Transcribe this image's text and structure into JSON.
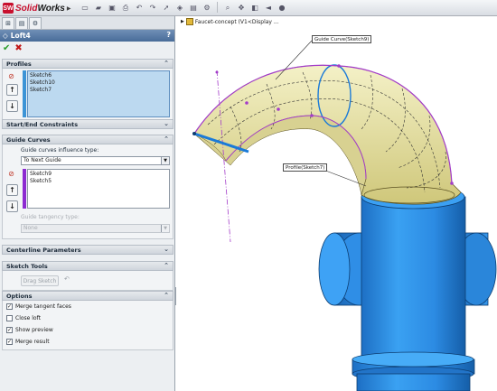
{
  "app": {
    "logo_mark": "SW",
    "brand_prefix": "Solid",
    "brand_suffix": "Works"
  },
  "toolbar": {
    "icons": [
      "new-icon",
      "open-icon",
      "save-icon",
      "print-icon",
      "undo-icon",
      "redo-icon",
      "select-icon",
      "rebuild-icon",
      "file-properties-icon",
      "options-icon",
      "zoom-icon",
      "view-orientation-icon",
      "display-style-icon",
      "section-view-icon",
      "appearance-icon"
    ]
  },
  "property_manager": {
    "title": "Loft4",
    "help": "?",
    "ok": "✔",
    "cancel": "✖",
    "profiles": {
      "header": "Profiles",
      "items": [
        "Sketch6",
        "Sketch10",
        "Sketch7"
      ]
    },
    "start_end": {
      "header": "Start/End Constraints"
    },
    "guide_curves": {
      "header": "Guide Curves",
      "influence_label": "Guide curves influence type:",
      "influence_value": "To Next Guide",
      "items": [
        "Sketch9",
        "Sketch5"
      ],
      "tangency_label": "Guide tangency type:",
      "tangency_value": "None"
    },
    "centerline": {
      "header": "Centerline Parameters"
    },
    "sketch_tools": {
      "header": "Sketch Tools",
      "drag_sketch": "Drag Sketch"
    },
    "options": {
      "header": "Options",
      "checkboxes": [
        {
          "label": "Merge tangent faces",
          "checked": true
        },
        {
          "label": "Close loft",
          "checked": false
        },
        {
          "label": "Show preview",
          "checked": true
        },
        {
          "label": "Merge result",
          "checked": true
        }
      ]
    }
  },
  "graphics": {
    "tree_text": "Faucet-concept  (V1<Display ...",
    "callout_guide": "Guide Curve(Sketch9)",
    "callout_profile": "Profile(Sketch7)",
    "colors": {
      "body_blue": "#2f8ee6",
      "loft_yellow": "#e7e3a4",
      "sketch_purple": "#a33cc9"
    }
  }
}
